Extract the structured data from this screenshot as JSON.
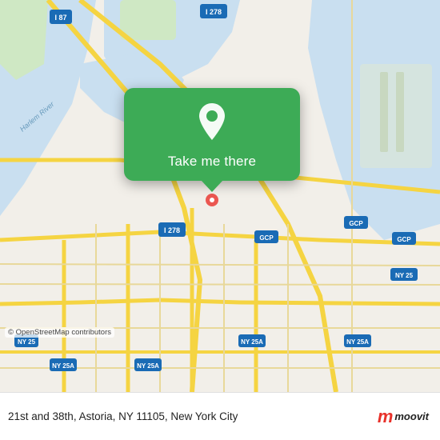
{
  "map": {
    "background_color": "#f2efe9",
    "osm_attribution": "© OpenStreetMap contributors"
  },
  "popup": {
    "button_label": "Take me there",
    "location_icon": "map-pin"
  },
  "bottom_bar": {
    "address": "21st and 38th, Astoria, NY 11105, New York City",
    "logo": {
      "letter": "m",
      "name": "moovit"
    }
  }
}
